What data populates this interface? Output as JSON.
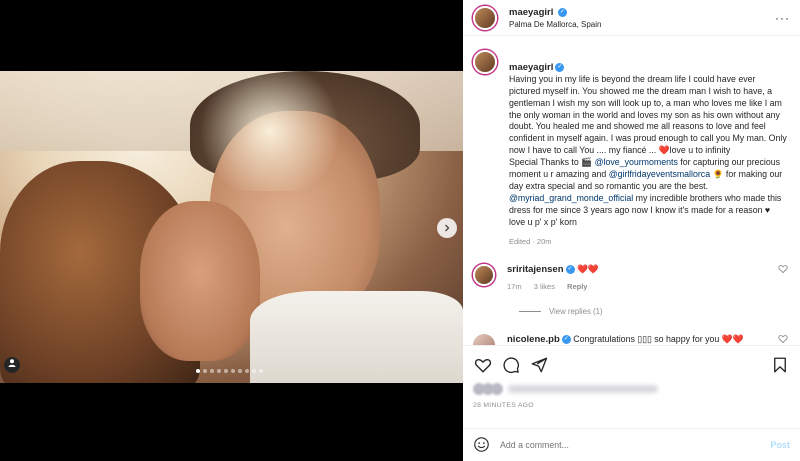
{
  "post": {
    "username": "maeyagirl",
    "location": "Palma De Mallorca, Spain",
    "more_icon": "···",
    "media": {
      "dot_count": 10,
      "active_dot": 0
    },
    "caption": {
      "username": "maeyagirl",
      "text_1": "Having you in my life is beyond the dream life I could have ever pictured myself in. You showed me the dream man I wish to have, a gentleman I wish my son will look up to, a man who loves me like I am the only woman in the world and loves my son as his own without any doubt. You healed me and showed me all reasons to love and feel confident in myself again. I was proud enough to call you My man. Only now I have to call You .... my fiancé ... ",
      "heart_1": "❤️",
      "text_2": "love u to infinity\nSpecial Thanks to 🎬 ",
      "mention_1": "@love_yourmoments",
      "text_3": " for capturing our precious moment u r amazing and ",
      "mention_2": "@girlfridayeventsmallorca",
      "text_4": " 🌻 for making our day extra special and so romantic you are the best. ",
      "mention_3": "@myriad_grand_monde_official",
      "text_5": " my incredible brothers who made this dress for me since 3 years ago now I know it's made for a reason ♥ love u p' x p' korn",
      "meta": "Edited · 20m"
    },
    "comments": [
      {
        "username": "sriritajensen",
        "text": "❤️❤️",
        "time": "17m",
        "likes": "3 likes",
        "reply": "Reply",
        "view_replies": "View replies (1)"
      },
      {
        "username": "nicolene.pb",
        "text": "Congratulations ▯▯▯ so happy for you ❤️❤️",
        "time": "",
        "likes": "",
        "reply": ""
      }
    ],
    "timestamp": "28 MINUTES AGO",
    "add_comment_placeholder": "Add a comment...",
    "post_label": "Post"
  },
  "colors": {
    "link": "#00376b",
    "verified": "#3897f0",
    "muted": "#8e8e8e",
    "post_button": "#b2dffc"
  }
}
